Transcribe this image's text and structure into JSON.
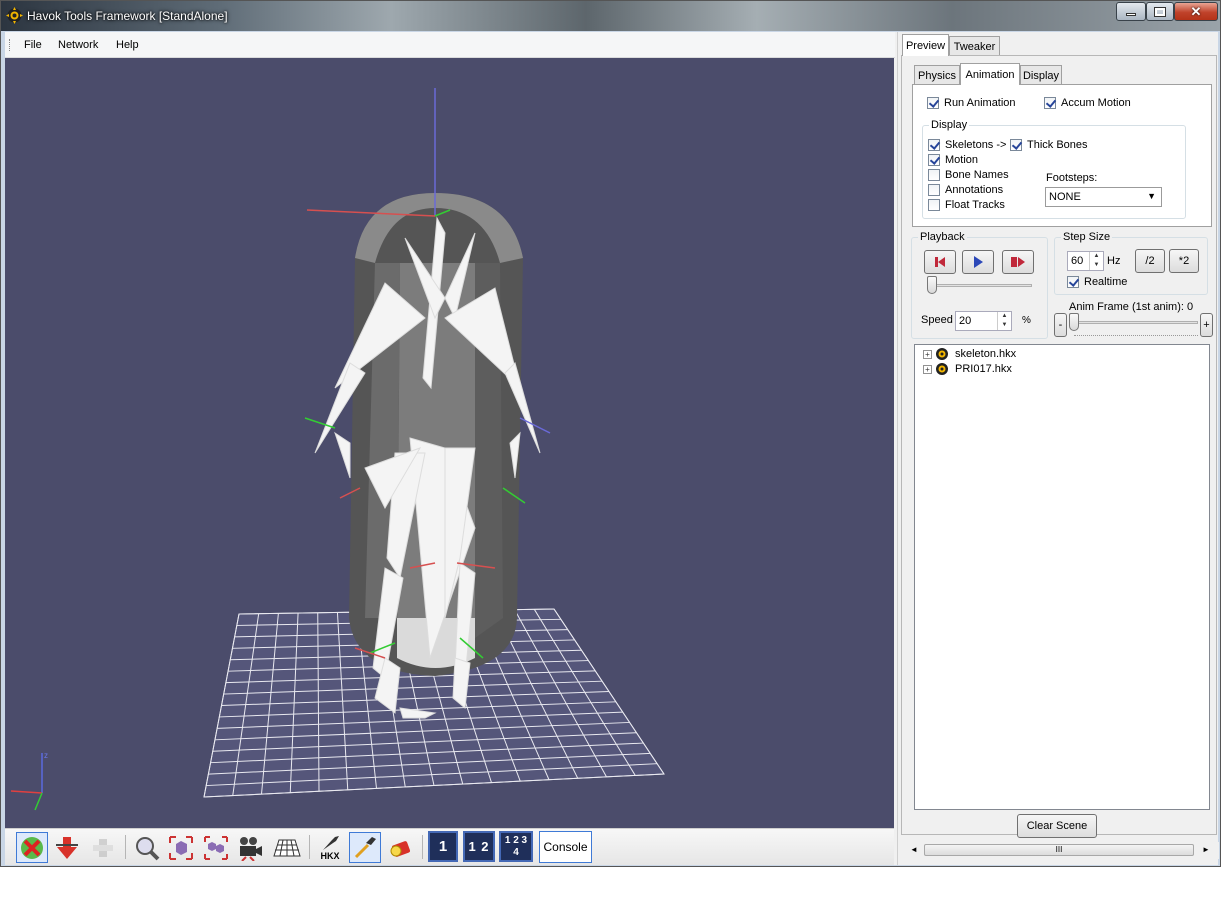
{
  "window": {
    "title": "Havok Tools Framework [StandAlone]"
  },
  "menu": [
    "File",
    "Network",
    "Help"
  ],
  "toolbar": {
    "icons": [
      "x-axis-icon",
      "down-arrow-icon",
      "disabled-icon",
      "zoom-icon",
      "cube-frame-icon",
      "cubes-icon",
      "camera-icon",
      "grid-icon",
      "hkx-wrench-icon",
      "wand-icon",
      "flashlight-icon"
    ],
    "hkx_label": "HKX",
    "layout_buttons": [
      "1",
      "1 2",
      "1 2 3 4"
    ],
    "console_label": "Console"
  },
  "tabs": {
    "main": [
      "Preview",
      "Tweaker"
    ],
    "active_main": "Preview",
    "sub": [
      "Physics",
      "Animation",
      "Display"
    ],
    "active_sub": "Animation"
  },
  "animation": {
    "run_animation": {
      "label": "Run Animation",
      "checked": true
    },
    "accum_motion": {
      "label": "Accum Motion",
      "checked": true
    },
    "display_group": "Display",
    "skeletons": {
      "label": "Skeletons ->",
      "checked": true
    },
    "thick_bones": {
      "label": "Thick Bones",
      "checked": true
    },
    "motion": {
      "label": "Motion",
      "checked": true
    },
    "bone_names": {
      "label": "Bone Names",
      "checked": false
    },
    "annotations": {
      "label": "Annotations",
      "checked": false
    },
    "float_tracks": {
      "label": "Float Tracks",
      "checked": false
    },
    "footsteps_label": "Footsteps:",
    "footsteps_value": "NONE"
  },
  "playback": {
    "label": "Playback",
    "speed_label": "Speed",
    "speed_value": "20",
    "speed_unit": "%",
    "position": 0
  },
  "step_size": {
    "label": "Step Size",
    "hz_value": "60",
    "hz_unit": "Hz",
    "half_label": "/2",
    "double_label": "*2",
    "realtime": {
      "label": "Realtime",
      "checked": true
    },
    "anim_frame_label": "Anim Frame (1st anim): 0",
    "minus": "-",
    "plus": "+"
  },
  "scene_tree": [
    {
      "label": "skeleton.hkx"
    },
    {
      "label": "PRI017.hkx"
    }
  ],
  "clear_scene": "Clear Scene",
  "scroll_label": "III",
  "colors": {
    "viewport": "#4b4c6b",
    "accent": "#3f7ad6"
  }
}
